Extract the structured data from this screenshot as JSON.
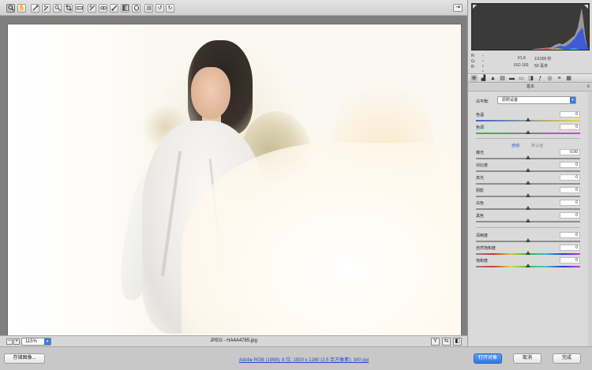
{
  "toolbar": {
    "tools": [
      {
        "name": "zoom-tool",
        "icon": "magnifier-icon"
      },
      {
        "name": "hand-tool",
        "icon": "hand-icon"
      },
      {
        "name": "white-balance-tool",
        "icon": "eyedropper-icon"
      },
      {
        "name": "color-sampler-tool",
        "icon": "sampler-icon"
      },
      {
        "name": "targeted-adjustment-tool",
        "icon": "target-adjust-icon"
      },
      {
        "name": "crop-tool",
        "icon": "crop-icon"
      },
      {
        "name": "straighten-tool",
        "icon": "straighten-icon"
      },
      {
        "name": "spot-removal-tool",
        "icon": "spot-removal-icon"
      },
      {
        "name": "red-eye-tool",
        "icon": "red-eye-icon"
      },
      {
        "name": "adjustment-brush-tool",
        "icon": "brush-icon"
      },
      {
        "name": "graduated-filter-tool",
        "icon": "graduated-filter-icon"
      },
      {
        "name": "radial-filter-tool",
        "icon": "radial-filter-icon"
      },
      {
        "name": "preferences-tool",
        "icon": "list-icon"
      },
      {
        "name": "rotate-left-tool",
        "icon": "rotate-left-icon"
      },
      {
        "name": "rotate-right-tool",
        "icon": "rotate-right-icon"
      }
    ],
    "fullscreen_icon": "fullscreen-icon"
  },
  "status": {
    "zoom_value": "115%",
    "filename": "JPEG - HA4A4785.jpg"
  },
  "readout": {
    "r_label": "R:",
    "r_value": "---",
    "g_label": "G:",
    "g_value": "---",
    "b_label": "B:",
    "b_value": "---",
    "aperture": "f/1.8",
    "shutter": "1/1000 秒",
    "iso": "ISO 100",
    "focal": "50 毫米"
  },
  "panel": {
    "section_title": "基本",
    "wb_label": "白平衡:",
    "wb_value": "原照设置",
    "auto_label": "自动",
    "default_label": "默认值",
    "sliders": [
      {
        "key": "temp",
        "label": "色温",
        "value": "0",
        "pos": 0.5,
        "track": "temp"
      },
      {
        "key": "tint",
        "label": "色调",
        "value": "0",
        "pos": 0.5,
        "track": "tint"
      },
      {
        "key": "exposure",
        "label": "曝光",
        "value": "0.00",
        "pos": 0.5,
        "track": "plain"
      },
      {
        "key": "contrast",
        "label": "对比度",
        "value": "0",
        "pos": 0.5,
        "track": "plain"
      },
      {
        "key": "highlights",
        "label": "高光",
        "value": "0",
        "pos": 0.5,
        "track": "plain"
      },
      {
        "key": "shadows",
        "label": "阴影",
        "value": "0",
        "pos": 0.5,
        "track": "plain"
      },
      {
        "key": "whites",
        "label": "白色",
        "value": "0",
        "pos": 0.5,
        "track": "plain"
      },
      {
        "key": "blacks",
        "label": "黑色",
        "value": "0",
        "pos": 0.5,
        "track": "plain"
      },
      {
        "key": "clarity",
        "label": "清晰度",
        "value": "0",
        "pos": 0.5,
        "track": "plain"
      },
      {
        "key": "vibrance",
        "label": "自然饱和度",
        "value": "0",
        "pos": 0.5,
        "track": "vib"
      },
      {
        "key": "saturation",
        "label": "饱和度",
        "value": "0",
        "pos": 0.5,
        "track": "sat"
      }
    ]
  },
  "bottom": {
    "save_label": "存储图像...",
    "workflow_link": "Adobe RGB (1998); 8 位; 1920 x 1280 (2.5 百万像素); 300 ppi",
    "open_label": "打开对象",
    "cancel_label": "取消",
    "done_label": "完成"
  },
  "colors": {
    "accent": "#2f78e4",
    "link": "#1a4bd4"
  }
}
